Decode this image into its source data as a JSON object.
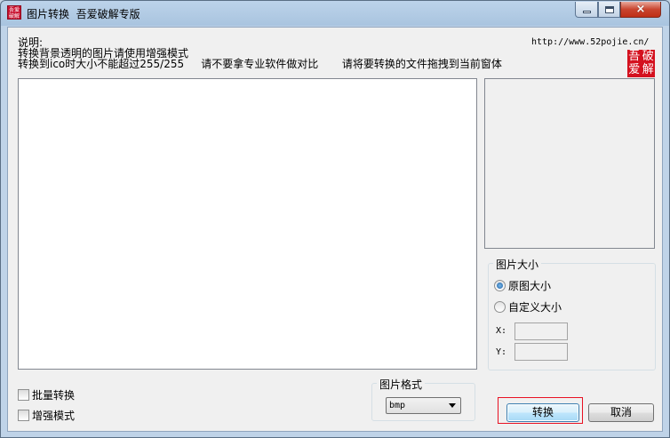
{
  "window": {
    "title": "图片转换  吾爱破解专版",
    "icon_text": "吾爱破解",
    "controls": {
      "minimize": "minimize-icon",
      "maximize": "maximize-icon",
      "close": "×"
    }
  },
  "info": {
    "heading": "说明:",
    "line1": "转换背景透明的图片请使用增强模式",
    "line2": "转换到ico时大小不能超过255/255     请不要拿专业软件做对比       请将要转换的文件拖拽到当前窗体",
    "url": "http://www.52pojie.cn/",
    "logo_chars": [
      "破",
      "吾",
      "解",
      "爱"
    ]
  },
  "size_group": {
    "title": "图片大小",
    "options": [
      {
        "label": "原图大小",
        "selected": true
      },
      {
        "label": "自定义大小",
        "selected": false
      }
    ],
    "x_label": "X:",
    "y_label": "Y:",
    "x_value": "",
    "y_value": ""
  },
  "options": {
    "batch_label": "批量转换",
    "batch_checked": false,
    "enhance_label": "增强模式",
    "enhance_checked": false
  },
  "format_group": {
    "title": "图片格式",
    "selected": "bmp"
  },
  "buttons": {
    "convert": "转换",
    "cancel": "取消"
  },
  "colors": {
    "logo_red": "#d4111f",
    "highlight_red": "#e81123",
    "close_button": "#c9452f"
  }
}
